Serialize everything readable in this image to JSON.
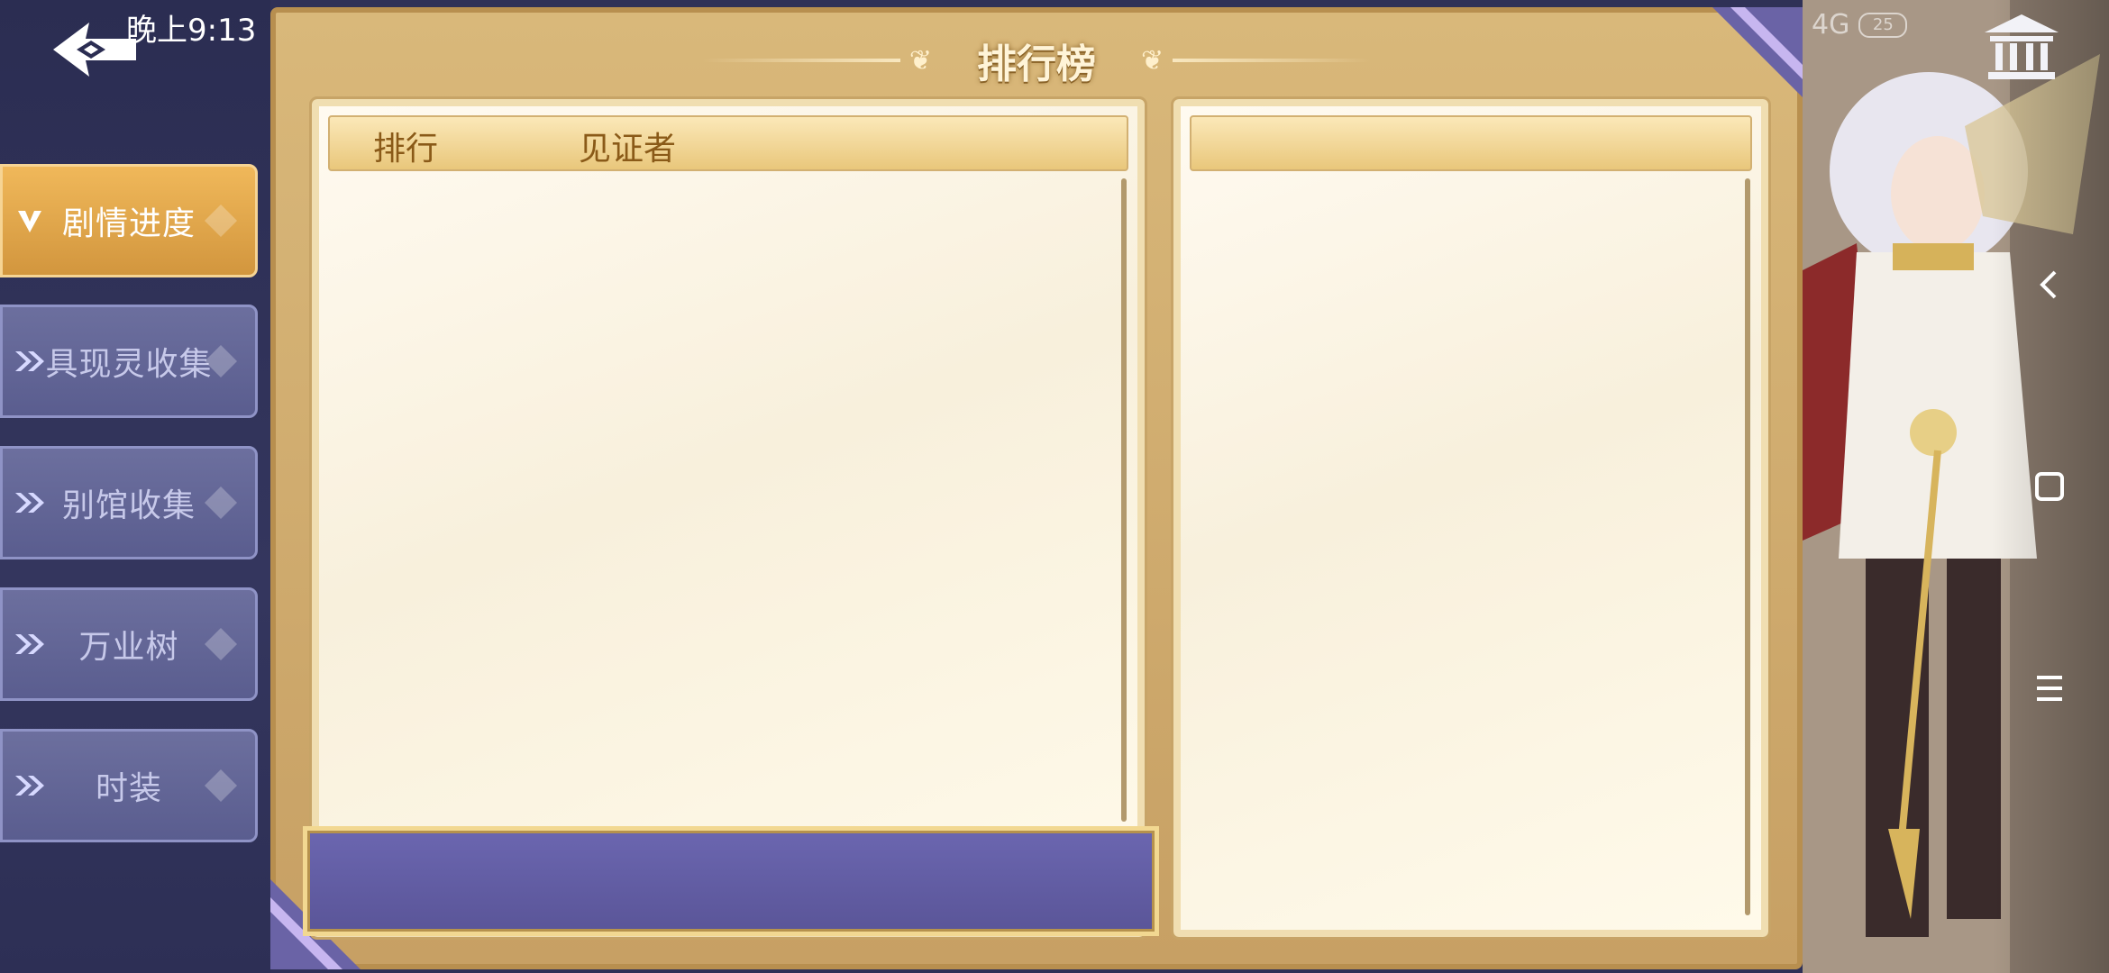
{
  "status_bar": {
    "time": "晚上9:13",
    "network": "4G",
    "battery": "25"
  },
  "board": {
    "title": "排行榜"
  },
  "sidebar": {
    "items": [
      {
        "label": "剧情进度",
        "active": true
      },
      {
        "label": "具现灵收集",
        "active": false
      },
      {
        "label": "别馆收集",
        "active": false
      },
      {
        "label": "万业树",
        "active": false
      },
      {
        "label": "时装",
        "active": false
      }
    ]
  },
  "leaderboard": {
    "columns": {
      "rank": "排行",
      "witness": "见证者"
    },
    "rows": []
  },
  "icons": {
    "back": "back-arrow-icon",
    "museum": "museum-icon",
    "nav_back": "chevron-left-icon",
    "nav_home": "square-icon",
    "nav_menu": "menu-icon"
  },
  "colors": {
    "sidebar_bg": "#2b2d52",
    "active_tab": "#e3a94c",
    "inactive_tab": "#61649a",
    "gold_frame": "#d4b273",
    "my_rank_bar": "#625da4"
  }
}
